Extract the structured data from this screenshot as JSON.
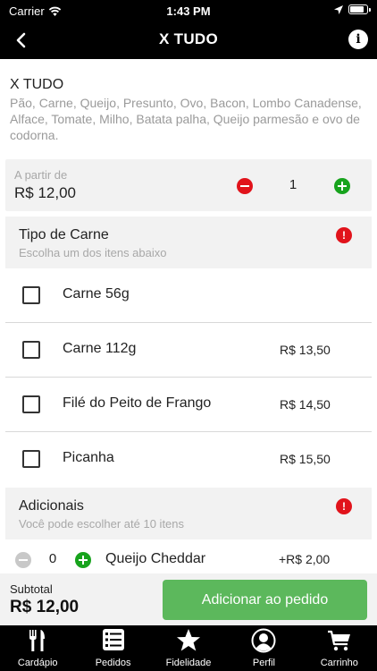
{
  "status_bar": {
    "carrier": "Carrier",
    "time": "1:43 PM",
    "battery_level": 0.9
  },
  "nav": {
    "title": "X TUDO",
    "info_symbol": "i"
  },
  "product": {
    "name": "X TUDO",
    "description": "Pão, Carne, Queijo, Presunto, Ovo, Bacon, Lombo Canadense, Alface, Tomate, Milho, Batata palha, Queijo parmesão e ovo de codorna."
  },
  "price_box": {
    "from_label": "A partir de",
    "price": "R$ 12,00",
    "quantity": "1"
  },
  "meat_section": {
    "title": "Tipo de Carne",
    "subtitle": "Escolha um dos itens abaixo",
    "alert_symbol": "!",
    "options": [
      {
        "label": "Carne 56g",
        "price": ""
      },
      {
        "label": "Carne 112g",
        "price": "R$ 13,50"
      },
      {
        "label": "Filé do Peito de Frango",
        "price": "R$ 14,50"
      },
      {
        "label": "Picanha",
        "price": "R$ 15,50"
      }
    ]
  },
  "addons_section": {
    "title": "Adicionais",
    "subtitle": "Você pode escolher até 10 itens",
    "alert_symbol": "!",
    "items": [
      {
        "quantity": "0",
        "label": "Queijo Cheddar",
        "price": "+R$ 2,00"
      }
    ]
  },
  "footer": {
    "subtotal_label": "Subtotal",
    "subtotal_value": "R$ 12,00",
    "add_button": "Adicionar ao pedido"
  },
  "tabbar": {
    "tabs": [
      {
        "label": "Cardápio",
        "icon": "fork-knife-icon"
      },
      {
        "label": "Pedidos",
        "icon": "list-icon"
      },
      {
        "label": "Fidelidade",
        "icon": "star-icon"
      },
      {
        "label": "Perfil",
        "icon": "user-icon"
      },
      {
        "label": "Carrinho",
        "icon": "cart-icon"
      }
    ]
  },
  "colors": {
    "accent_green": "#5cb85c",
    "remove_red": "#e1131b",
    "add_green": "#17a31d",
    "bar_black": "#000000"
  }
}
